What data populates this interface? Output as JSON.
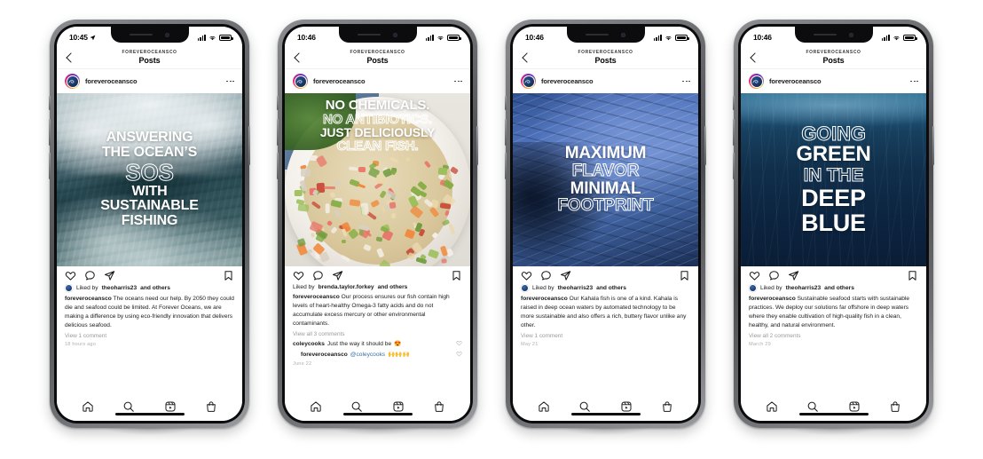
{
  "app": {
    "brand_handle": "foreveroceansco",
    "nav_eyebrow": "FOREVEROCEANSCO",
    "nav_title": "Posts",
    "accent_link_color": "#3a6ea5",
    "story_ring_colors": [
      "#f9ce34",
      "#ee2a7b",
      "#6228d7"
    ]
  },
  "icons": {
    "back": "chevron-left-icon",
    "more": "more-options-icon",
    "like": "heart-icon",
    "comment": "comment-bubble-icon",
    "share": "share-paperplane-icon",
    "save": "bookmark-icon",
    "home": "home-icon",
    "search": "search-icon",
    "reels": "reels-icon",
    "shop": "shop-bag-icon",
    "cellular": "cellular-signal-icon",
    "wifi": "wifi-icon",
    "battery": "battery-icon",
    "location": "location-arrow-icon"
  },
  "tabbar": {
    "items": [
      {
        "name": "home",
        "label": "Home"
      },
      {
        "name": "search",
        "label": "Search"
      },
      {
        "name": "reels",
        "label": "Reels"
      },
      {
        "name": "shop",
        "label": "Shop"
      }
    ]
  },
  "phones": [
    {
      "id": "phone-1",
      "status_time": "10:45",
      "has_location_arrow": true,
      "media_style": "ocean-wave",
      "overlay_lines": [
        {
          "text": "ANSWERING",
          "style": "solid",
          "size": 16
        },
        {
          "text": "THE OCEAN’S",
          "style": "solid",
          "size": 16
        },
        {
          "text": "SOS",
          "style": "outline",
          "size": 26
        },
        {
          "text": "WITH",
          "style": "solid",
          "size": 16
        },
        {
          "text": "SUSTAINABLE",
          "style": "solid",
          "size": 16
        },
        {
          "text": "FISHING",
          "style": "solid",
          "size": 16
        }
      ],
      "liked_by_prefix": "Liked by",
      "liked_by_user": "theoharris23",
      "liked_by_suffix": "and others",
      "liked_has_avatar": true,
      "caption_user": "foreveroceansco",
      "caption_text": "The oceans need our help. By 2050 they could die and seafood could be limited. At Forever Oceans, we are making a difference by using eco-friendly innovation that delivers delicious seafood.",
      "comments_link": "View 1 comment",
      "comments": [],
      "timestamp": "18 hours ago"
    },
    {
      "id": "phone-2",
      "status_time": "10:46",
      "has_location_arrow": false,
      "media_style": "ceviche-plate",
      "overlay_lines": [
        {
          "text": "NO CHEMICALS.",
          "style": "solid",
          "size": 15
        },
        {
          "text": "NO ANTIBIOTICS.",
          "style": "outline",
          "size": 15
        },
        {
          "text": "JUST DELICIOUSLY",
          "style": "solid",
          "size": 14
        },
        {
          "text": "CLEAN FISH.",
          "style": "outline",
          "size": 15
        }
      ],
      "overlay_align": "top",
      "liked_by_prefix": "Liked by",
      "liked_by_user": "brenda.taylor.forkey",
      "liked_by_suffix": "and others",
      "liked_has_avatar": false,
      "caption_user": "foreveroceansco",
      "caption_text": "Our process ensures our fish contain high levels of heart-healthy Omega-3 fatty acids and do not accumulate excess mercury or other environmental contaminants.",
      "comments_link": "View all 3 comments",
      "comments": [
        {
          "user": "coleycooks",
          "text": "Just the way it should be",
          "emoji": "😍",
          "reply": false
        },
        {
          "user": "foreveroceansco",
          "mention": "@coleycooks",
          "text": "",
          "emoji": "🙌🙌🙌",
          "reply": true
        }
      ],
      "timestamp": "June 22"
    },
    {
      "id": "phone-3",
      "status_time": "10:46",
      "has_location_arrow": false,
      "media_style": "school-of-fish",
      "overlay_lines": [
        {
          "text": "MAXIMUM",
          "style": "solid",
          "size": 19
        },
        {
          "text": "FLAVOR",
          "style": "outline",
          "size": 19
        },
        {
          "text": "MINIMAL",
          "style": "solid",
          "size": 19
        },
        {
          "text": "FOOTPRINT",
          "style": "outline",
          "size": 19
        }
      ],
      "liked_by_prefix": "Liked by",
      "liked_by_user": "theoharris23",
      "liked_by_suffix": "and others",
      "liked_has_avatar": true,
      "caption_user": "foreveroceansco",
      "caption_text": "Our Kahala fish is one of a kind. Kahala is raised in deep ocean waters by automated technology to be more sustainable and also offers a rich, buttery flavor unlike any other.",
      "comments_link": "View 1 comment",
      "comments": [],
      "timestamp": "May 21"
    },
    {
      "id": "phone-4",
      "status_time": "10:46",
      "has_location_arrow": false,
      "media_style": "deep-blue",
      "overlay_lines": [
        {
          "text": "GOING",
          "style": "outline",
          "size": 22
        },
        {
          "text": "GREEN",
          "style": "solid",
          "size": 24
        },
        {
          "text": "IN THE",
          "style": "outline",
          "size": 21
        },
        {
          "text": "DEEP",
          "style": "solid",
          "size": 27
        },
        {
          "text": "BLUE",
          "style": "solid",
          "size": 27
        }
      ],
      "liked_by_prefix": "Liked by",
      "liked_by_user": "theoharris23",
      "liked_by_suffix": "and others",
      "liked_has_avatar": true,
      "caption_user": "foreveroceansco",
      "caption_text": "Sustainable seafood starts with sustainable practices. We deploy our solutions far offshore in deep waters where they enable cultivation of high-quality fish in a clean, healthy, and natural environment.",
      "comments_link": "View all 2 comments",
      "comments": [],
      "timestamp": "March 29"
    }
  ]
}
